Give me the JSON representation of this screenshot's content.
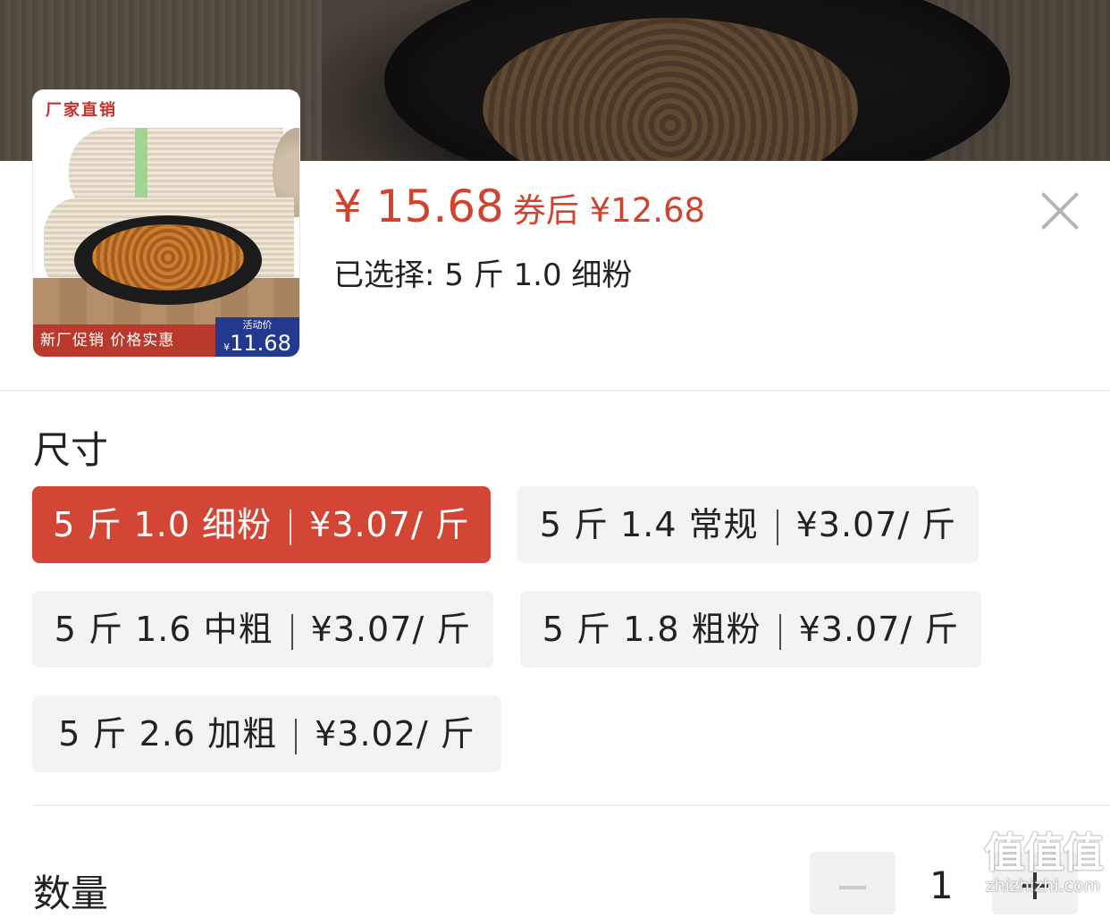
{
  "product": {
    "thumb": {
      "top_promo": "厂家直销",
      "bottom_promo": "新厂促销 价格实惠",
      "activity_label": "活动价",
      "activity_currency": "¥",
      "activity_price": "11.68"
    },
    "price": "¥ 15.68",
    "coupon_price": "券后 ¥12.68",
    "selected_text": "已选择: 5 斤 1.0 细粉"
  },
  "size_section": {
    "title": "尺寸",
    "options": [
      {
        "name": "5 斤 1.0 细粉",
        "price": "¥3.07/ 斤",
        "selected": true
      },
      {
        "name": "5 斤 1.4 常规",
        "price": "¥3.07/ 斤",
        "selected": false
      },
      {
        "name": "5 斤 1.6 中粗",
        "price": "¥3.07/ 斤",
        "selected": false
      },
      {
        "name": "5 斤 1.8 粗粉",
        "price": "¥3.07/ 斤",
        "selected": false
      },
      {
        "name": "5 斤 2.6 加粗",
        "price": "¥3.02/ 斤",
        "selected": false
      }
    ]
  },
  "quantity_section": {
    "title": "数量",
    "value": "1"
  },
  "watermark": {
    "big": "值值值",
    "small": "zhizhizhi.com"
  },
  "colors": {
    "accent": "#d34534",
    "price": "#d0432f",
    "option_bg": "#f3f3f3"
  }
}
